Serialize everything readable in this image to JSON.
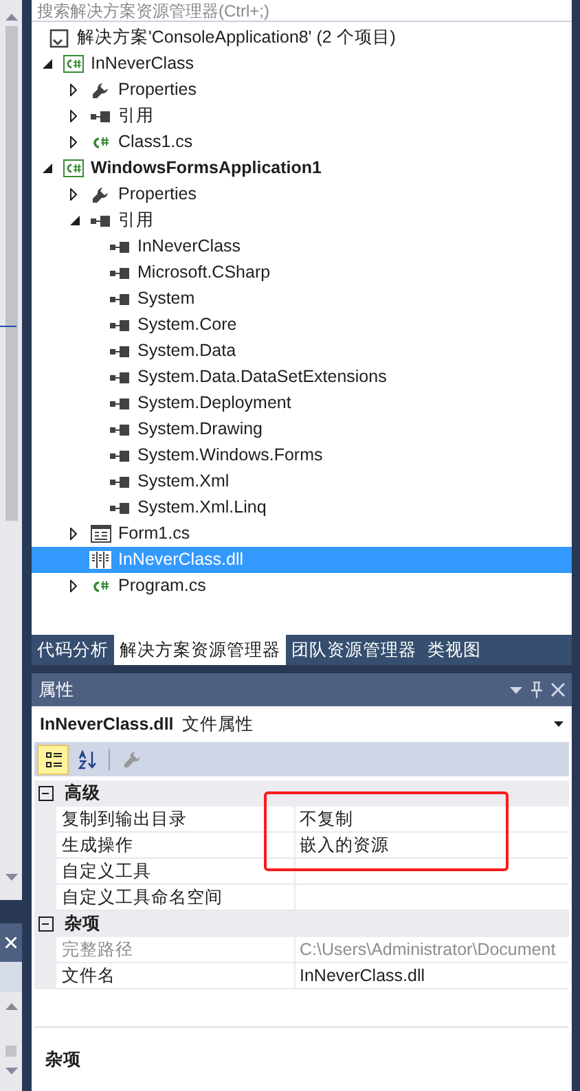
{
  "search": {
    "placeholder": "搜索解决方案资源管理器(Ctrl+;)"
  },
  "tree": [
    {
      "kind": "solution",
      "label": "解决方案'ConsoleApplication8' (2 个项目)",
      "selected": false,
      "children": [
        {
          "kind": "csharp-project",
          "label": "InNeverClass",
          "bold": false,
          "expanded": true,
          "selected": false,
          "children": [
            {
              "kind": "wrench",
              "label": "Properties",
              "expanded": false,
              "selected": false
            },
            {
              "kind": "references",
              "label": "引用",
              "expanded": false,
              "selected": false
            },
            {
              "kind": "cs-file",
              "label": "Class1.cs",
              "expanded": false,
              "selected": false
            }
          ]
        },
        {
          "kind": "csharp-project",
          "label": "WindowsFormsApplication1",
          "bold": true,
          "expanded": true,
          "selected": false,
          "children": [
            {
              "kind": "wrench",
              "label": "Properties",
              "expanded": false,
              "selected": false
            },
            {
              "kind": "references",
              "label": "引用",
              "expanded": true,
              "selected": false,
              "children": [
                {
                  "kind": "reference",
                  "label": "InNeverClass",
                  "selected": false
                },
                {
                  "kind": "reference",
                  "label": "Microsoft.CSharp",
                  "selected": false
                },
                {
                  "kind": "reference",
                  "label": "System",
                  "selected": false
                },
                {
                  "kind": "reference",
                  "label": "System.Core",
                  "selected": false
                },
                {
                  "kind": "reference",
                  "label": "System.Data",
                  "selected": false
                },
                {
                  "kind": "reference",
                  "label": "System.Data.DataSetExtensions",
                  "selected": false
                },
                {
                  "kind": "reference",
                  "label": "System.Deployment",
                  "selected": false
                },
                {
                  "kind": "reference",
                  "label": "System.Drawing",
                  "selected": false
                },
                {
                  "kind": "reference",
                  "label": "System.Windows.Forms",
                  "selected": false
                },
                {
                  "kind": "reference",
                  "label": "System.Xml",
                  "selected": false
                },
                {
                  "kind": "reference",
                  "label": "System.Xml.Linq",
                  "selected": false
                }
              ]
            },
            {
              "kind": "form",
              "label": "Form1.cs",
              "expanded": false,
              "selected": false
            },
            {
              "kind": "dll",
              "label": "InNeverClass.dll",
              "selected": true
            },
            {
              "kind": "cs-file",
              "label": "Program.cs",
              "expanded": false,
              "selected": false
            }
          ]
        }
      ]
    }
  ],
  "tabs": [
    {
      "label": "代码分析",
      "selected": false
    },
    {
      "label": "解决方案资源管理器",
      "selected": true
    },
    {
      "label": "团队资源管理器",
      "selected": false
    },
    {
      "label": "类视图",
      "selected": false
    }
  ],
  "properties": {
    "title": "属性",
    "object_name": "InNeverClass.dll",
    "object_type": "文件属性",
    "toolbar": [
      {
        "kind": "categorized",
        "selected": true
      },
      {
        "kind": "alphabetical",
        "selected": false
      },
      {
        "kind": "property-pages",
        "selected": false
      }
    ],
    "categories": [
      {
        "name": "高级",
        "expanded": true,
        "rows": [
          {
            "name": "复制到输出目录",
            "value": "不复制",
            "disabled": false
          },
          {
            "name": "生成操作",
            "value": "嵌入的资源",
            "disabled": false
          },
          {
            "name": "自定义工具",
            "disabled": false
          },
          {
            "name": "自定义工具命名空间",
            "disabled": false
          }
        ]
      },
      {
        "name": "杂项",
        "expanded": true,
        "rows": [
          {
            "name": "完整路径",
            "value": "C:\\Users\\Administrator\\Document",
            "disabled": true
          },
          {
            "name": "文件名",
            "value": "InNeverClass.dll",
            "disabled": false
          }
        ]
      }
    ],
    "description": "杂项"
  }
}
